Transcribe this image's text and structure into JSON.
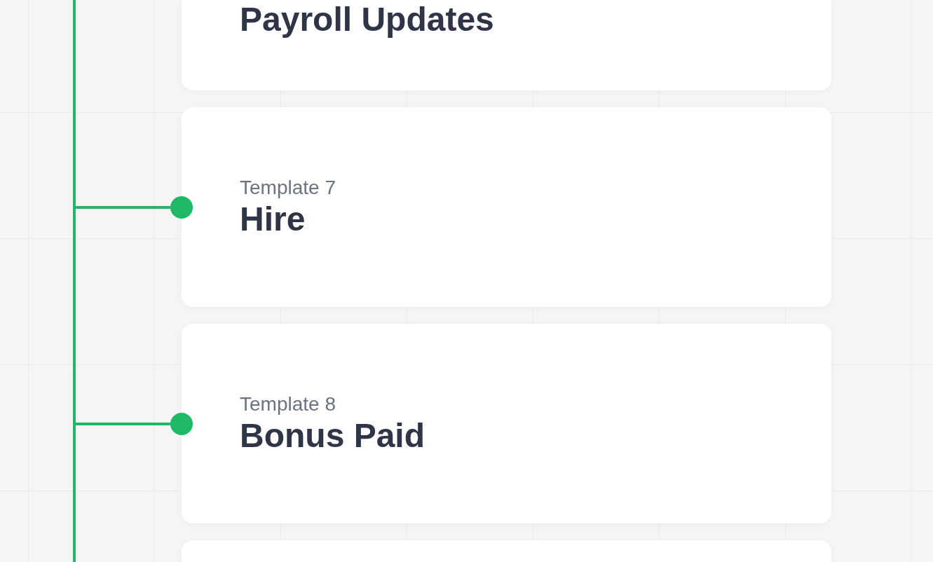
{
  "cards": [
    {
      "kind": "cut_top",
      "title": "Payroll Updates"
    },
    {
      "kind": "full",
      "label": "Template 7",
      "title": "Hire"
    },
    {
      "kind": "full",
      "label": "Template 8",
      "title": "Bonus Paid"
    },
    {
      "kind": "cut_bottom"
    }
  ]
}
